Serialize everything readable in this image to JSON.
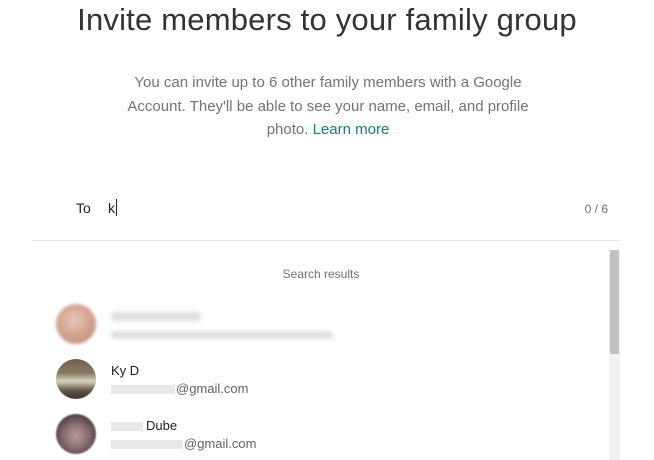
{
  "header": {
    "title": "Invite members to your family group",
    "description": "You can invite up to 6 other family members with a Google Account. They'll be able to see your name, email, and profile photo.",
    "learn_more": "Learn more"
  },
  "invite": {
    "to_label": "To",
    "input_value": "k",
    "counter": "0 / 6"
  },
  "results": {
    "header": "Search results",
    "items": [
      {
        "name": "",
        "email": "",
        "redacted": true,
        "avatar": "blurred-photo"
      },
      {
        "name": "Ky D",
        "email": "@gmail.com",
        "avatar": "room-photo"
      },
      {
        "name": "Dube",
        "email": "@gmail.com",
        "avatar": "blurred-face-photo"
      }
    ]
  },
  "colors": {
    "accent_link": "#11826c",
    "title_text": "#333333",
    "body_text": "#737373",
    "divider": "#e4e4e4"
  }
}
